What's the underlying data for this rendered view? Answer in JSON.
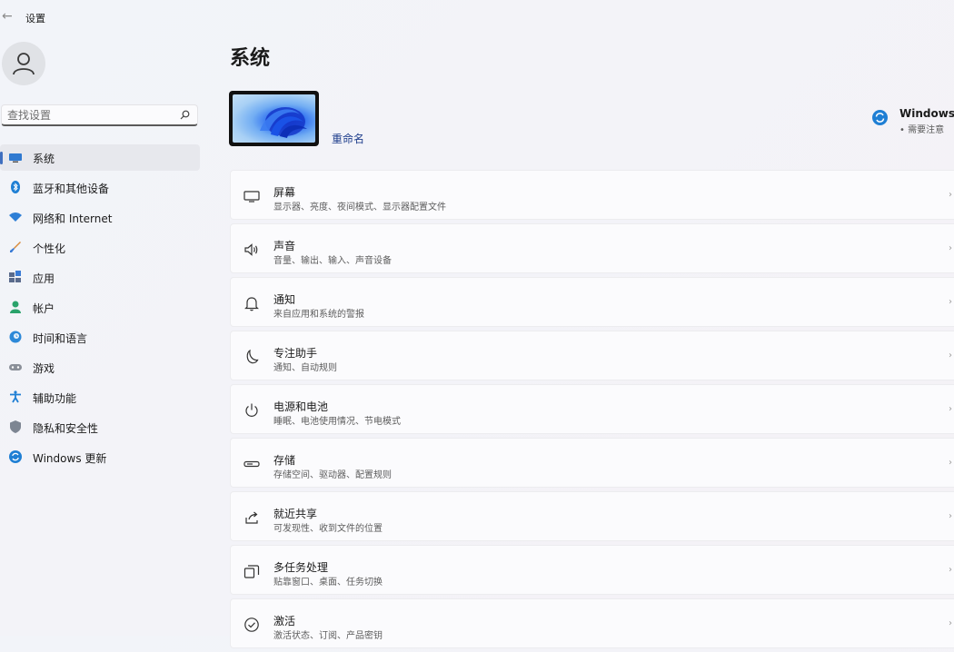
{
  "app": {
    "title": "设置"
  },
  "search": {
    "placeholder": "查找设置"
  },
  "nav": [
    {
      "label": "系统",
      "icon": "monitor-icon",
      "active": true
    },
    {
      "label": "蓝牙和其他设备",
      "icon": "bluetooth-icon"
    },
    {
      "label": "网络和 Internet",
      "icon": "wifi-icon"
    },
    {
      "label": "个性化",
      "icon": "brush-icon"
    },
    {
      "label": "应用",
      "icon": "apps-icon"
    },
    {
      "label": "帐户",
      "icon": "person-icon"
    },
    {
      "label": "时间和语言",
      "icon": "globe-clock-icon"
    },
    {
      "label": "游戏",
      "icon": "gamepad-icon"
    },
    {
      "label": "辅助功能",
      "icon": "accessibility-icon"
    },
    {
      "label": "隐私和安全性",
      "icon": "shield-icon"
    },
    {
      "label": "Windows 更新",
      "icon": "update-icon"
    }
  ],
  "main": {
    "title": "系统",
    "device": {
      "rename_label": "重命名"
    },
    "update": {
      "title": "Windows 更",
      "status": "• 需要注意"
    },
    "cards": [
      {
        "title": "屏幕",
        "desc": "显示器、亮度、夜间模式、显示器配置文件",
        "icon": "display-icon"
      },
      {
        "title": "声音",
        "desc": "音量、输出、输入、声音设备",
        "icon": "speaker-icon"
      },
      {
        "title": "通知",
        "desc": "来自应用和系统的警报",
        "icon": "bell-icon"
      },
      {
        "title": "专注助手",
        "desc": "通知、自动规则",
        "icon": "moon-icon"
      },
      {
        "title": "电源和电池",
        "desc": "睡眠、电池使用情况、节电模式",
        "icon": "power-icon"
      },
      {
        "title": "存储",
        "desc": "存储空间、驱动器、配置规则",
        "icon": "storage-icon"
      },
      {
        "title": "就近共享",
        "desc": "可发现性、收到文件的位置",
        "icon": "share-icon"
      },
      {
        "title": "多任务处理",
        "desc": "贴靠窗口、桌面、任务切换",
        "icon": "multitask-icon"
      },
      {
        "title": "激活",
        "desc": "激活状态、订阅、产品密钥",
        "icon": "check-circle-icon"
      }
    ]
  },
  "colors": {
    "accent": "#3f6fbf",
    "link": "#1f3e8c",
    "update_blue": "#1f7fd4"
  }
}
